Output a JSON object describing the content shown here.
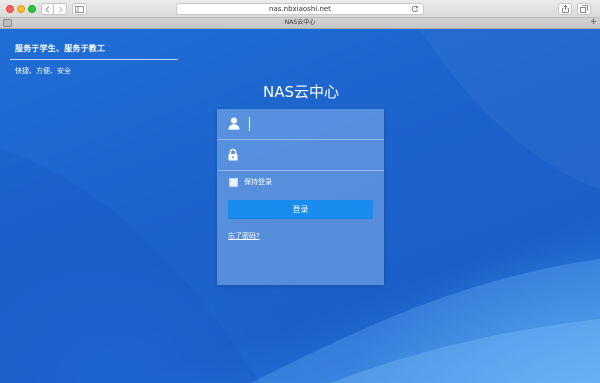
{
  "browser": {
    "url": "nas.nbxiaoshi.net",
    "tab_title": "NAS云中心",
    "icons": {
      "back": "chevron-left-icon",
      "forward": "chevron-right-icon",
      "sidebar": "sidebar-icon",
      "reload": "reload-icon",
      "share": "share-icon",
      "tabs": "tabs-overview-icon",
      "new_tab": "plus-icon"
    },
    "new_tab_glyph": "+"
  },
  "page": {
    "tagline_title": "服务于学生、服务于教工",
    "tagline_subtitle": "快捷、方便、安全",
    "site_title": "NAS云中心",
    "login": {
      "username_value": "",
      "password_value": "",
      "remember_label": "保持登录",
      "remember_checked": false,
      "submit_label": "登录",
      "forgot_label": "忘了密码?",
      "username_icon": "user-icon",
      "password_icon": "lock-icon"
    }
  },
  "colors": {
    "background": "#1d63cc",
    "button": "#1a8cf0",
    "card": "rgba(170,205,245,0.42)"
  }
}
